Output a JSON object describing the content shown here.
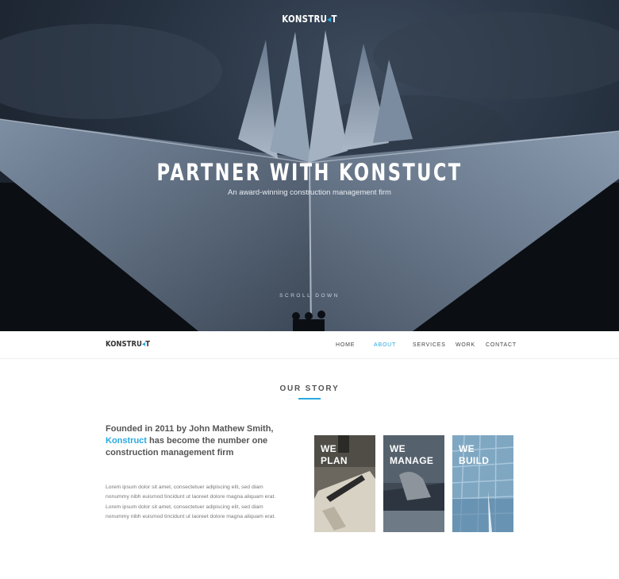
{
  "hero": {
    "logo_pre": "KONSTRU",
    "logo_accent": "◂",
    "logo_post": "T",
    "title": "PARTNER WITH KONSTUCT",
    "subtitle": "An award-winning construction management firm",
    "scroll_label": "SCROLL DOWN"
  },
  "nav": {
    "logo_pre": "KONSTRU",
    "logo_accent": "◂",
    "logo_post": "T",
    "items": [
      {
        "label": "HOME"
      },
      {
        "label": "ABOUT"
      },
      {
        "label": "SERVICES"
      },
      {
        "label": "WORK"
      },
      {
        "label": "CONTACT"
      }
    ],
    "active": "ABOUT"
  },
  "story": {
    "title": "OUR STORY",
    "headline_pre": "Founded in 2011 by John Mathew Smith, ",
    "headline_brand": "Konstruct",
    "headline_post": " has become the number one construction management firm",
    "body": "Lorem ipsum dolor sit amet, consectetuer adipiscing elit, sed diam nonummy nibh euismod tincidunt ut laoreet dolore magna aliquam erat. Lorem ipsum dolor sit amet, consectetuer adipiscing elit, sed diam nonummy nibh euismod tincidunt ut laoreet dolore magna aliquam erat."
  },
  "cards": [
    {
      "line1": "WE",
      "line2": "PLAN"
    },
    {
      "line1": "WE",
      "line2": "MANAGE"
    },
    {
      "line1": "WE",
      "line2": "BUILD"
    }
  ],
  "colors": {
    "accent": "#29a9e0",
    "text": "#555555"
  }
}
